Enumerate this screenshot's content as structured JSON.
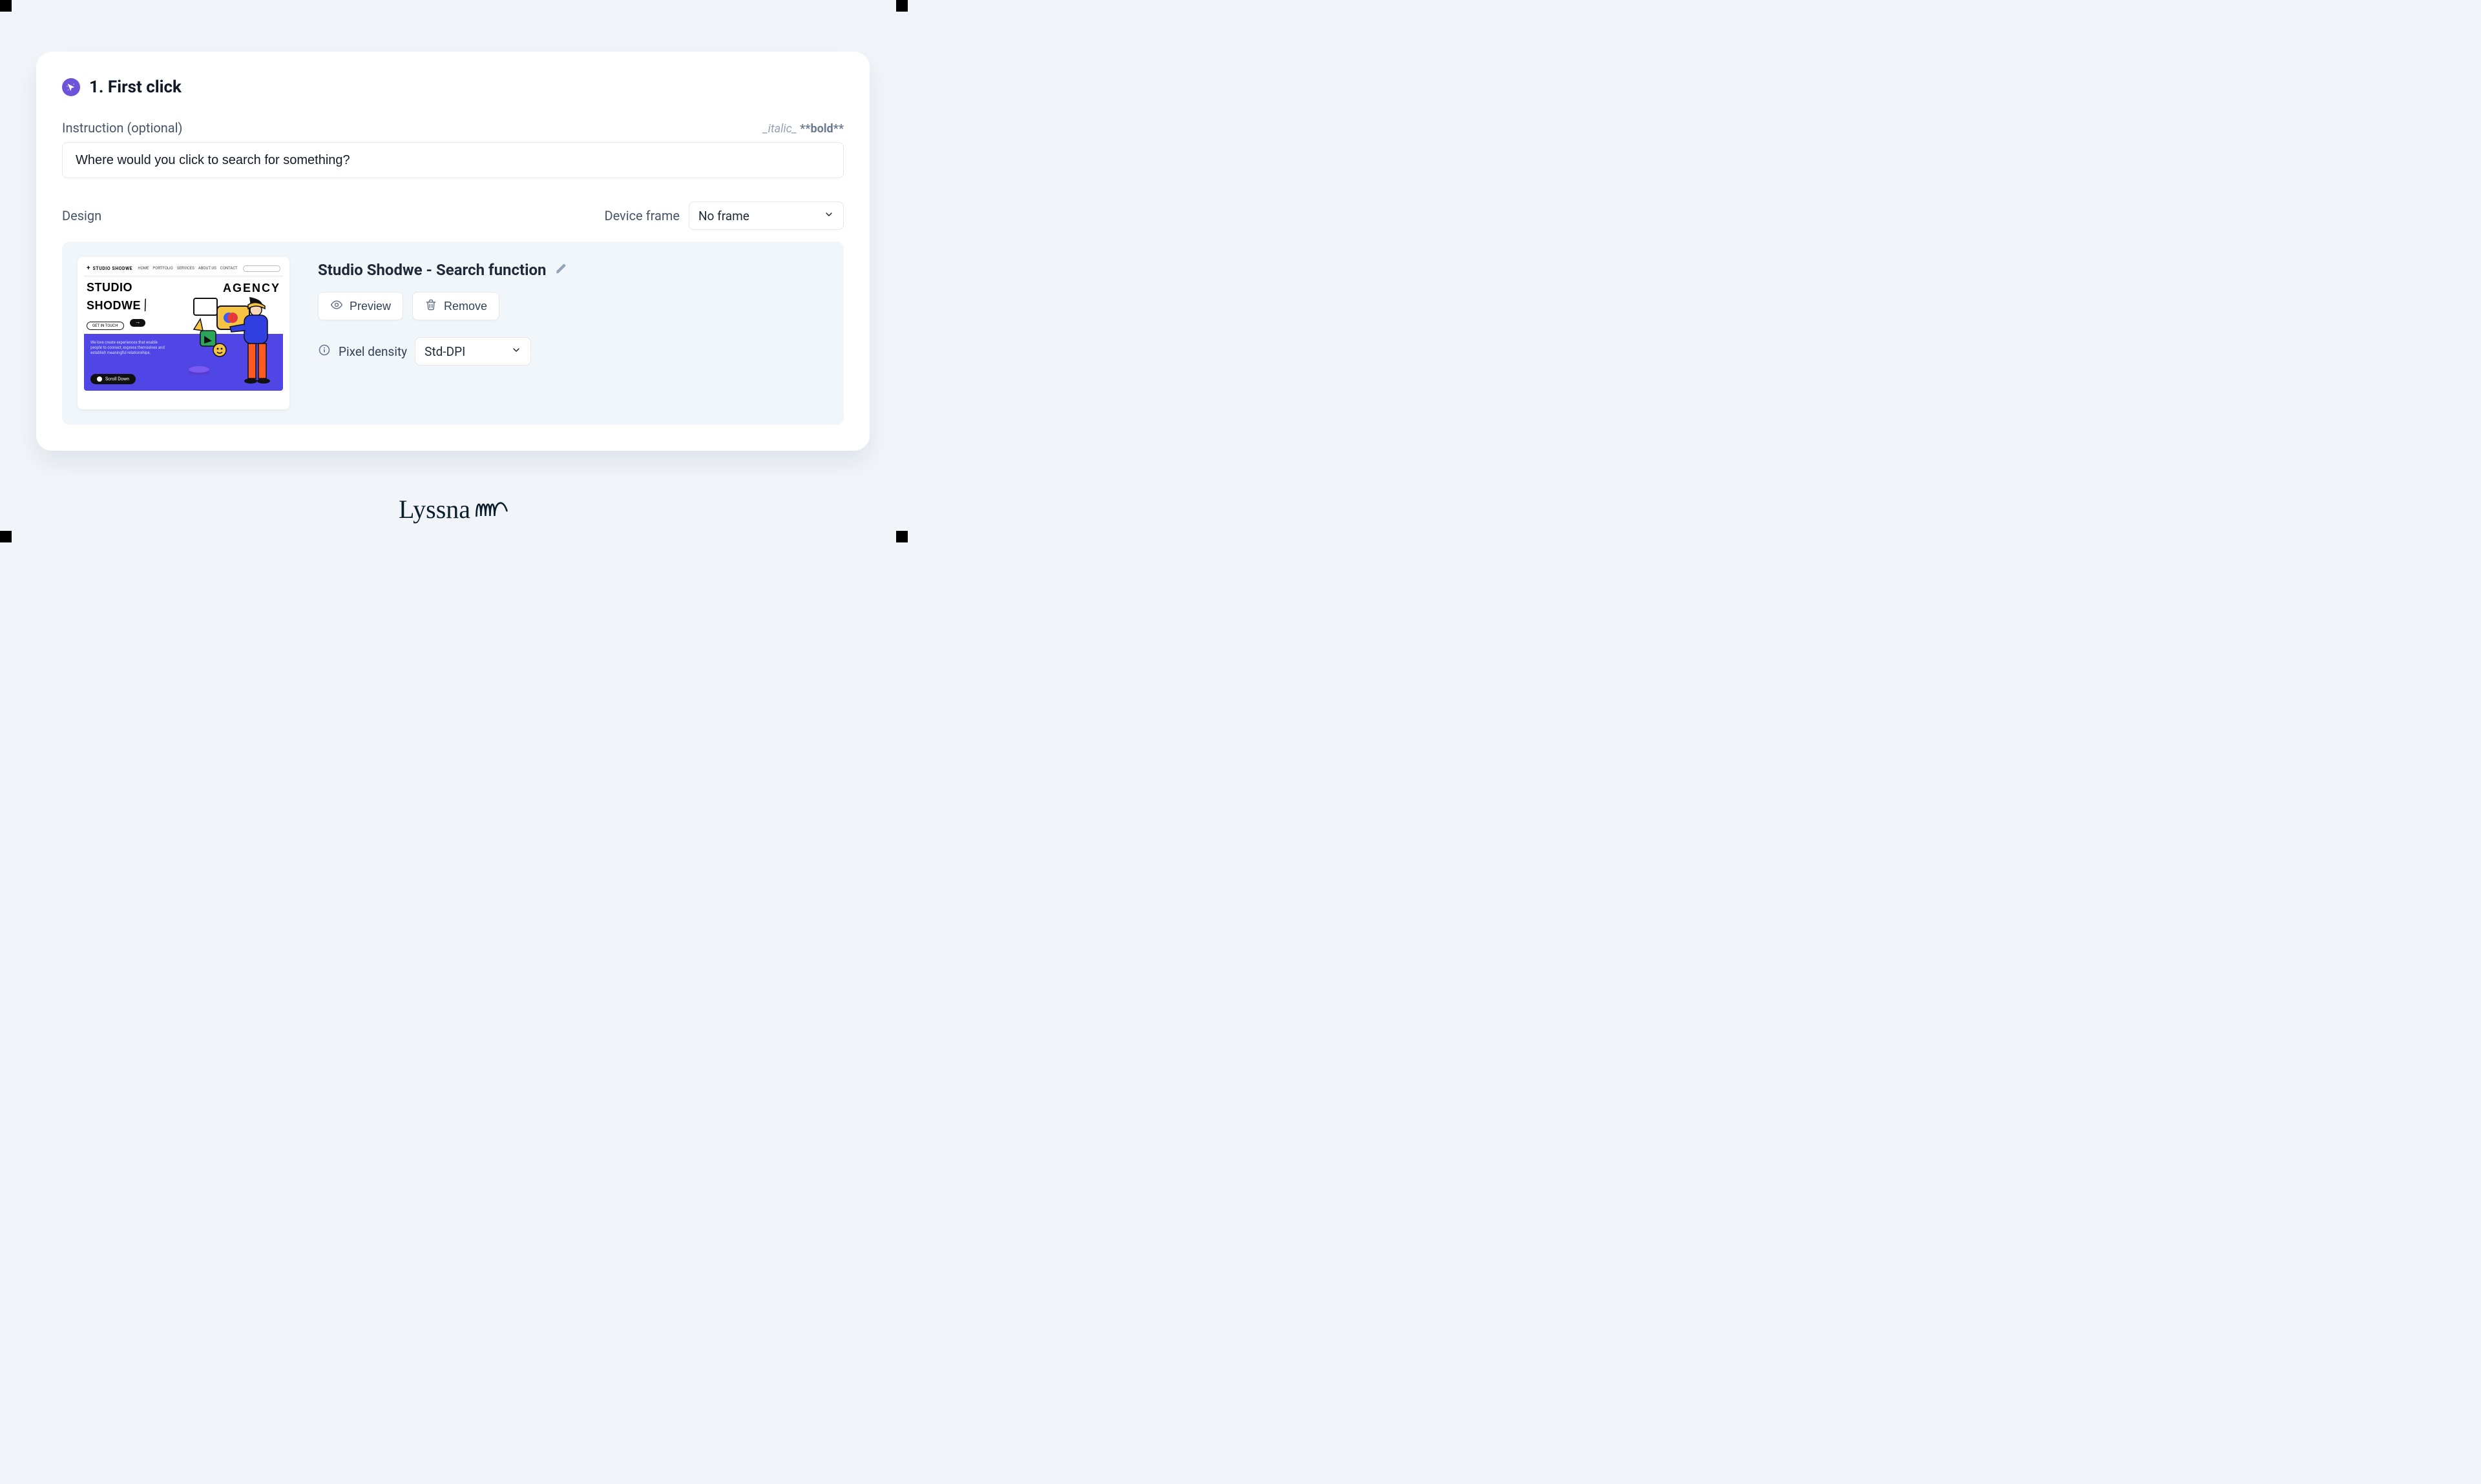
{
  "header": {
    "title": "1. First click"
  },
  "instruction": {
    "label": "Instruction (optional)",
    "value": "Where would you click to search for something?",
    "format_italic": "_italic_",
    "format_bold": "**bold**"
  },
  "design": {
    "label": "Design",
    "device_frame_label": "Device frame",
    "device_frame_value": "No frame",
    "title": "Studio Shodwe - Search function",
    "preview_label": "Preview",
    "remove_label": "Remove",
    "pixel_density_label": "Pixel density",
    "pixel_density_value": "Std-DPI"
  },
  "thumb": {
    "brand": "STUDIO SHODWE",
    "nav": {
      "home": "HOME",
      "portfolio": "PORTFOLIO",
      "services": "SERVICES",
      "about": "ABOUT US",
      "contact": "CONTACT"
    },
    "big1": "STUDIO",
    "big2": "SHODWE",
    "agency": "AGENCY",
    "get_in_touch": "GET IN TOUCH",
    "copy": "We love create experiences that enable people to connect, express themselves and establish meaningful relationships.",
    "scroll": "Scroll Down"
  },
  "brand": {
    "name": "Lyssna"
  }
}
